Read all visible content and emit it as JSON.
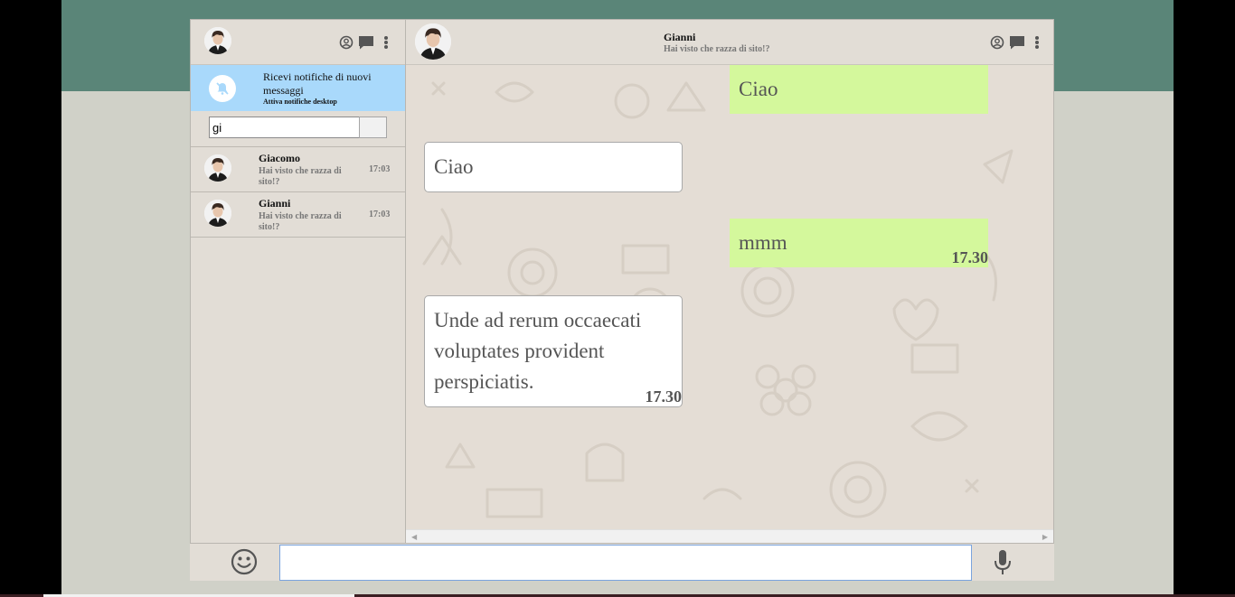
{
  "sidebar": {
    "notification": {
      "title": "Ricevi notifiche di nuovi messaggi",
      "link": "Attiva notifiche desktop",
      "icon": "bell-off-icon"
    },
    "search": {
      "value": "gi",
      "placeholder": ""
    },
    "contacts": [
      {
        "name": "Giacomo",
        "last_message": "Hai visto che razza di sito!?",
        "time": "17:03"
      },
      {
        "name": "Gianni",
        "last_message": "Hai visto che razza di sito!?",
        "time": "17:03"
      }
    ]
  },
  "chat": {
    "contact_name": "Gianni",
    "status": "Hai visto che razza di sito!?",
    "messages": [
      {
        "direction": "out",
        "text": "Ciao",
        "time": ""
      },
      {
        "direction": "in",
        "text": "Ciao",
        "time": ""
      },
      {
        "direction": "out",
        "text": "mmm",
        "time": "17.30"
      },
      {
        "direction": "in",
        "text": "Unde ad rerum occaecati voluptates provident perspiciatis.",
        "time": "17.30"
      }
    ]
  },
  "composer": {
    "value": "",
    "placeholder": ""
  },
  "colors": {
    "accent_top": "#5a8578",
    "panel": "#e2ddd6",
    "notification_bg": "#a9d9fb",
    "outgoing_bubble": "#d4f89c",
    "incoming_bubble": "#ffffff"
  }
}
